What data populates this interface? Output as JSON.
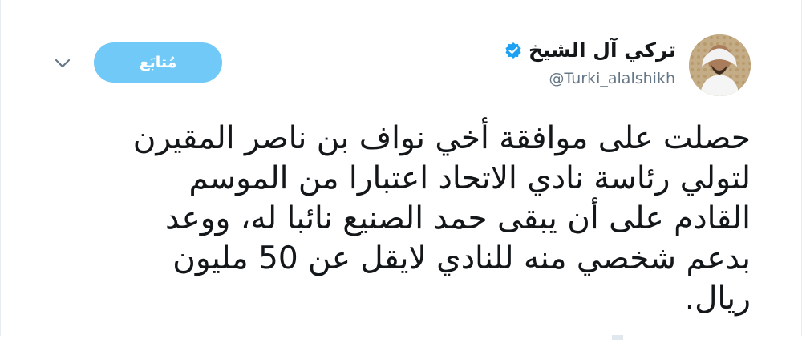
{
  "user": {
    "display_name": "تركي آل الشيخ",
    "handle": "@Turki_alalshikh",
    "verified": true,
    "avatar_icon": "profile-photo"
  },
  "follow": {
    "label": "مُتابَع",
    "color": "#71c9f8"
  },
  "tweet": {
    "lines": [
      "حصلت على موافقة أخي نواف بن ناصر المقيرن",
      "لتولي رئاسة نادي الاتحاد اعتبارا من الموسم",
      "القادم على أن يبقى حمد الصنيع نائبا له، ووعد",
      "بدعم شخصي منه للنادي لايقل عن 50 مليون",
      "ريال."
    ]
  },
  "icons": {
    "caret": "chevron-down-icon",
    "verified": "verified-badge-icon"
  },
  "colors": {
    "text": "#14171a",
    "secondary": "#657786",
    "verified": "#1da1f2"
  }
}
